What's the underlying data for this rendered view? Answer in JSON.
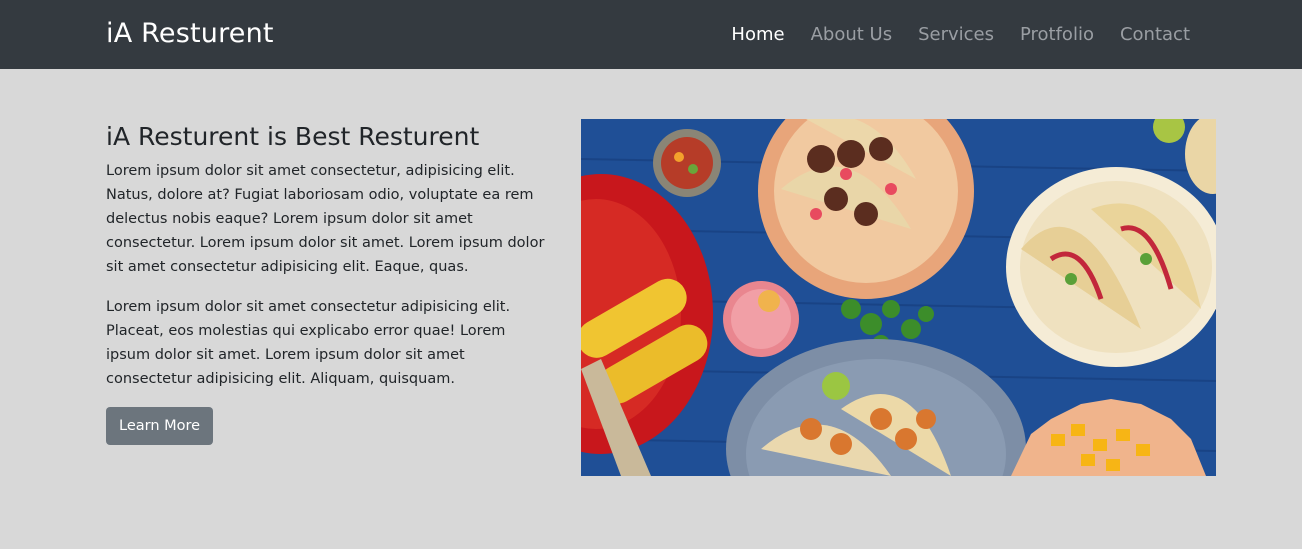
{
  "navbar": {
    "brand": "iA Resturent",
    "items": [
      {
        "label": "Home",
        "active": true
      },
      {
        "label": "About Us",
        "active": false
      },
      {
        "label": "Services",
        "active": false
      },
      {
        "label": "Protfolio",
        "active": false
      },
      {
        "label": "Contact",
        "active": false
      }
    ]
  },
  "main": {
    "heading": "iA Resturent is Best Resturent",
    "paragraph1": "Lorem ipsum dolor sit amet consectetur, adipisicing elit. Natus, dolore at? Fugiat laboriosam odio, voluptate ea rem delectus nobis eaque? Lorem ipsum dolor sit amet consectetur. Lorem ipsum dolor sit amet. Lorem ipsum dolor sit amet consectetur adipisicing elit. Eaque, quas.",
    "paragraph2": "Lorem ipsum dolor sit amet consectetur adipisicing elit. Placeat, eos molestias qui explicabo error quae! Lorem ipsum dolor sit amet. Lorem ipsum dolor sit amet consectetur adipisicing elit. Aliquam, quisquam.",
    "button_label": "Learn More"
  },
  "colors": {
    "navbar_bg": "#343a40",
    "page_bg": "#d8d8d8",
    "button_bg": "#6c757d",
    "nav_active": "#ffffff",
    "nav_inactive": "#9a9ea3"
  }
}
